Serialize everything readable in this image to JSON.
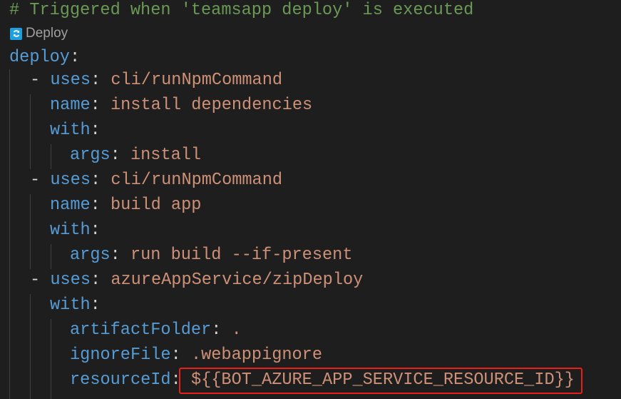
{
  "editor": {
    "language": "yaml",
    "colors": {
      "background": "#1e1e1e",
      "comment": "#6a9955",
      "key": "#569cd6",
      "string": "#ce9178",
      "punctuation": "#d4d4d4",
      "highlight_box": "#e8201a",
      "codelens_icon": "#1ba1e2"
    },
    "comment_line": "# Triggered when 'teamsapp deploy' is executed",
    "codelens": {
      "icon": "refresh-icon",
      "label": "Deploy"
    },
    "root_key": "deploy",
    "steps": [
      {
        "uses": "cli/runNpmCommand",
        "name": "install dependencies",
        "with": [
          {
            "key": "args",
            "value": "install"
          }
        ]
      },
      {
        "uses": "cli/runNpmCommand",
        "name": "build app",
        "with": [
          {
            "key": "args",
            "value": "run build --if-present"
          }
        ]
      },
      {
        "uses": "azureAppService/zipDeploy",
        "with": [
          {
            "key": "artifactFolder",
            "value": "."
          },
          {
            "key": "ignoreFile",
            "value": ".webappignore"
          },
          {
            "key": "resourceId",
            "value": "${{BOT_AZURE_APP_SERVICE_RESOURCE_ID}}",
            "highlighted": true
          }
        ]
      }
    ],
    "labels": {
      "uses": "uses",
      "name": "name",
      "with": "with",
      "colon": ":",
      "dash": "-"
    }
  }
}
